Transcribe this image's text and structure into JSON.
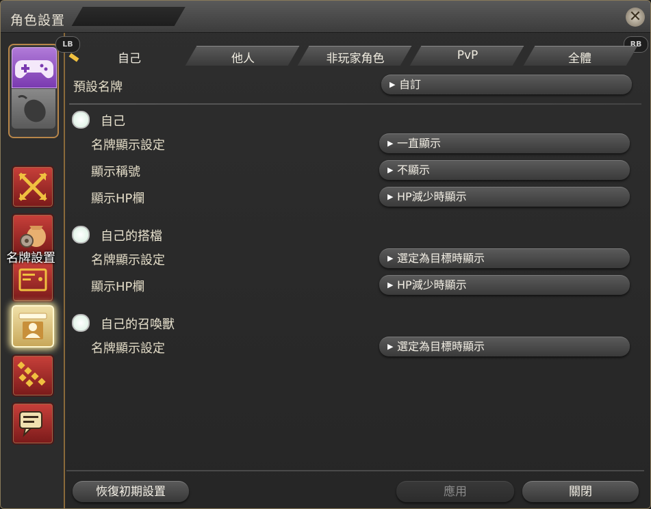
{
  "window": {
    "title": "角色設置"
  },
  "badges": {
    "lb": "LB",
    "rb": "RB"
  },
  "tabs": [
    {
      "label": "自己",
      "active": true
    },
    {
      "label": "他人",
      "active": false
    },
    {
      "label": "非玩家角色",
      "active": false
    },
    {
      "label": "PvP",
      "active": false
    },
    {
      "label": "全體",
      "active": false
    }
  ],
  "sidebar": {
    "tooltip": "名牌設置",
    "icons": [
      "gamepad-icon",
      "mouse-icon",
      "battle-icon",
      "character-bag-icon",
      "hud-icon",
      "nameplate-icon",
      "hotbar-icon",
      "chat-icon"
    ]
  },
  "preset": {
    "label": "預設名牌",
    "value": "自訂"
  },
  "sections": [
    {
      "title": "自己",
      "rows": [
        {
          "label": "名牌顯示設定",
          "value": "一直顯示"
        },
        {
          "label": "顯示稱號",
          "value": "不顯示"
        },
        {
          "label": "顯示HP欄",
          "value": "HP減少時顯示"
        }
      ]
    },
    {
      "title": "自己的搭檔",
      "rows": [
        {
          "label": "名牌顯示設定",
          "value": "選定為目標時顯示"
        },
        {
          "label": "顯示HP欄",
          "value": "HP減少時顯示"
        }
      ]
    },
    {
      "title": "自己的召喚獸",
      "rows": [
        {
          "label": "名牌顯示設定",
          "value": "選定為目標時顯示"
        }
      ]
    }
  ],
  "footer": {
    "reset": "恢復初期設置",
    "apply": "應用",
    "close": "關閉"
  }
}
